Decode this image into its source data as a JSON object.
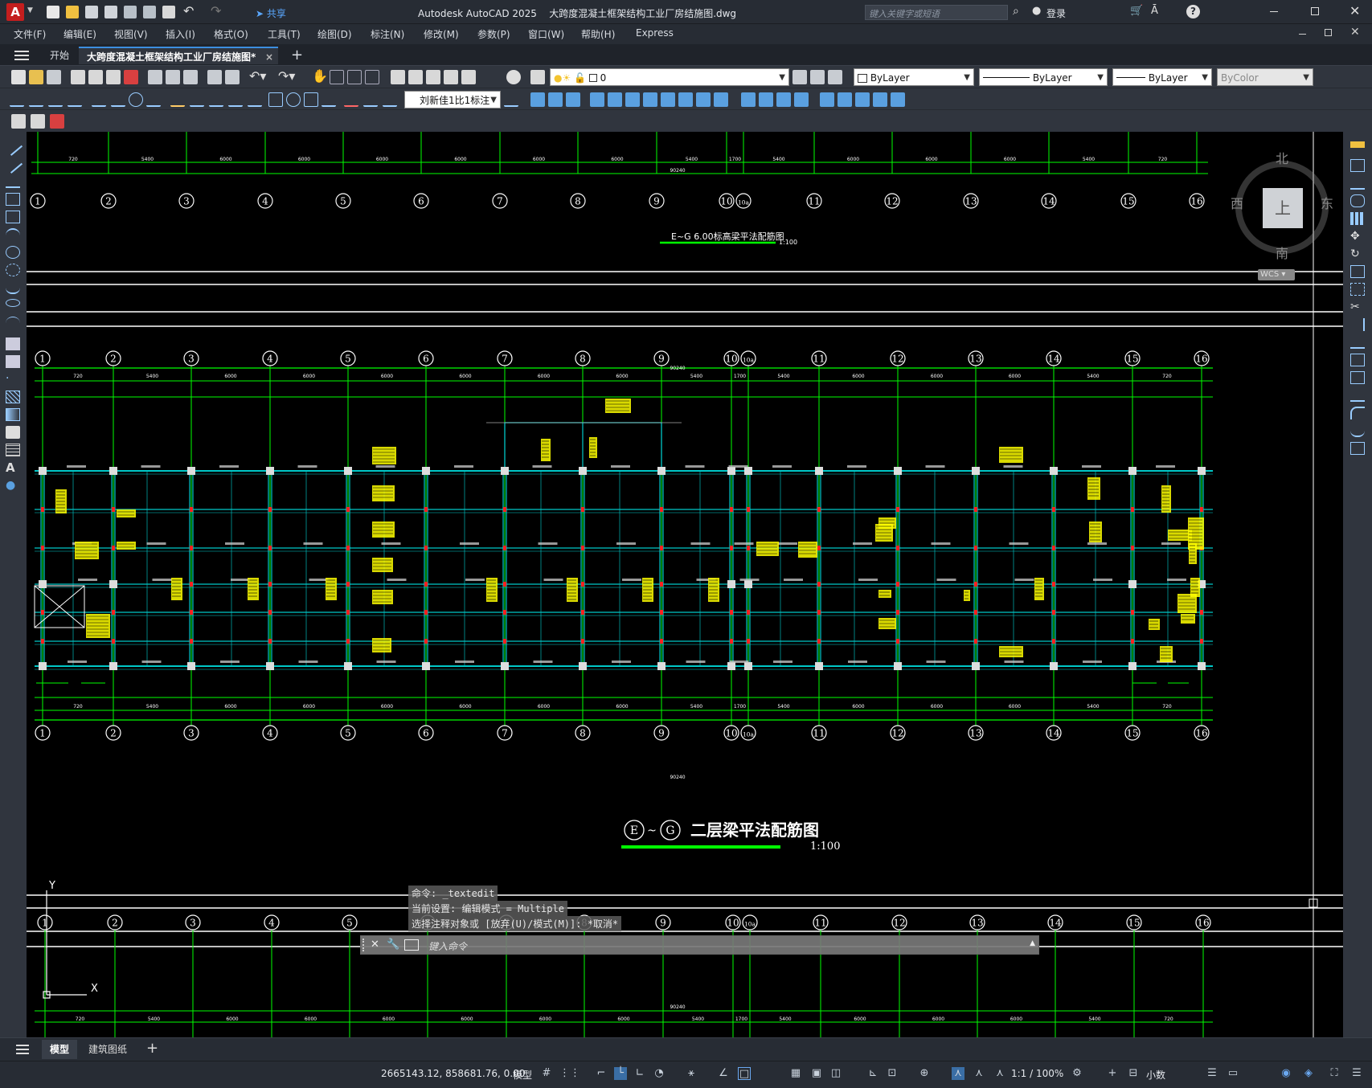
{
  "window": {
    "app_title": "Autodesk AutoCAD 2025",
    "doc_title": "大跨度混凝土框架结构工业厂房结施图.dwg",
    "share_label": "共享",
    "search_placeholder": "键入关键字或短语",
    "login_label": "登录",
    "app_letter": "A"
  },
  "menu": [
    "文件(F)",
    "编辑(E)",
    "视图(V)",
    "插入(I)",
    "格式(O)",
    "工具(T)",
    "绘图(D)",
    "标注(N)",
    "修改(M)",
    "参数(P)",
    "窗口(W)",
    "帮助(H)",
    "Express"
  ],
  "tabs": {
    "start": "开始",
    "active": "大跨度混凝土框架结构工业厂房结施图*",
    "close": "×",
    "add": "+"
  },
  "toolbar": {
    "layer_value": "0",
    "color_value": "ByLayer",
    "linetype_value": "ByLayer",
    "lineweight_value": "ByLayer",
    "plotstyle_value": "ByColor",
    "dimstyle_value": "刘新佳1比1标注"
  },
  "viewcube": {
    "north": "北",
    "south": "南",
    "east": "东",
    "west": "西",
    "top": "上",
    "wcs": "WCS"
  },
  "drawing": {
    "axis_labels": [
      "1",
      "2",
      "3",
      "4",
      "5",
      "6",
      "7",
      "8",
      "9",
      "10",
      "10a",
      "11",
      "12",
      "13",
      "14",
      "15",
      "16"
    ],
    "bays_top": [
      "720",
      "5400",
      "6000",
      "6000",
      "6000",
      "6000",
      "6000",
      "6000",
      "5400",
      "1700",
      "5400",
      "6000",
      "6000",
      "6000",
      "5400",
      "720"
    ],
    "total_dim": "90240",
    "upper_title": "E~G 6.00标高梁平法配筋图",
    "upper_scale": "1:100",
    "main_title": "二层梁平法配筋图",
    "title_prefix_a": "E",
    "title_prefix_b": "G",
    "title_sep": "~",
    "main_scale": "1:100"
  },
  "command": {
    "line1": "命令: _textedit",
    "line2": "当前设置: 编辑模式 = Multiple",
    "line3": "选择注释对象或 [放弃(U)/模式(M)]: *取消*",
    "placeholder": "键入命令"
  },
  "layout_tabs": {
    "model": "模型",
    "layout1": "建筑图纸",
    "add": "+"
  },
  "status": {
    "coords": "2665143.12, 858681.76, 0.00",
    "model": "模型",
    "scale": "1:1 / 100%",
    "units": "小数"
  },
  "colors": {
    "accent_red": "#c41e1e",
    "cad_green": "#00ff00",
    "cad_cyan": "#00d0d0",
    "cad_yellow": "#ffff00"
  }
}
